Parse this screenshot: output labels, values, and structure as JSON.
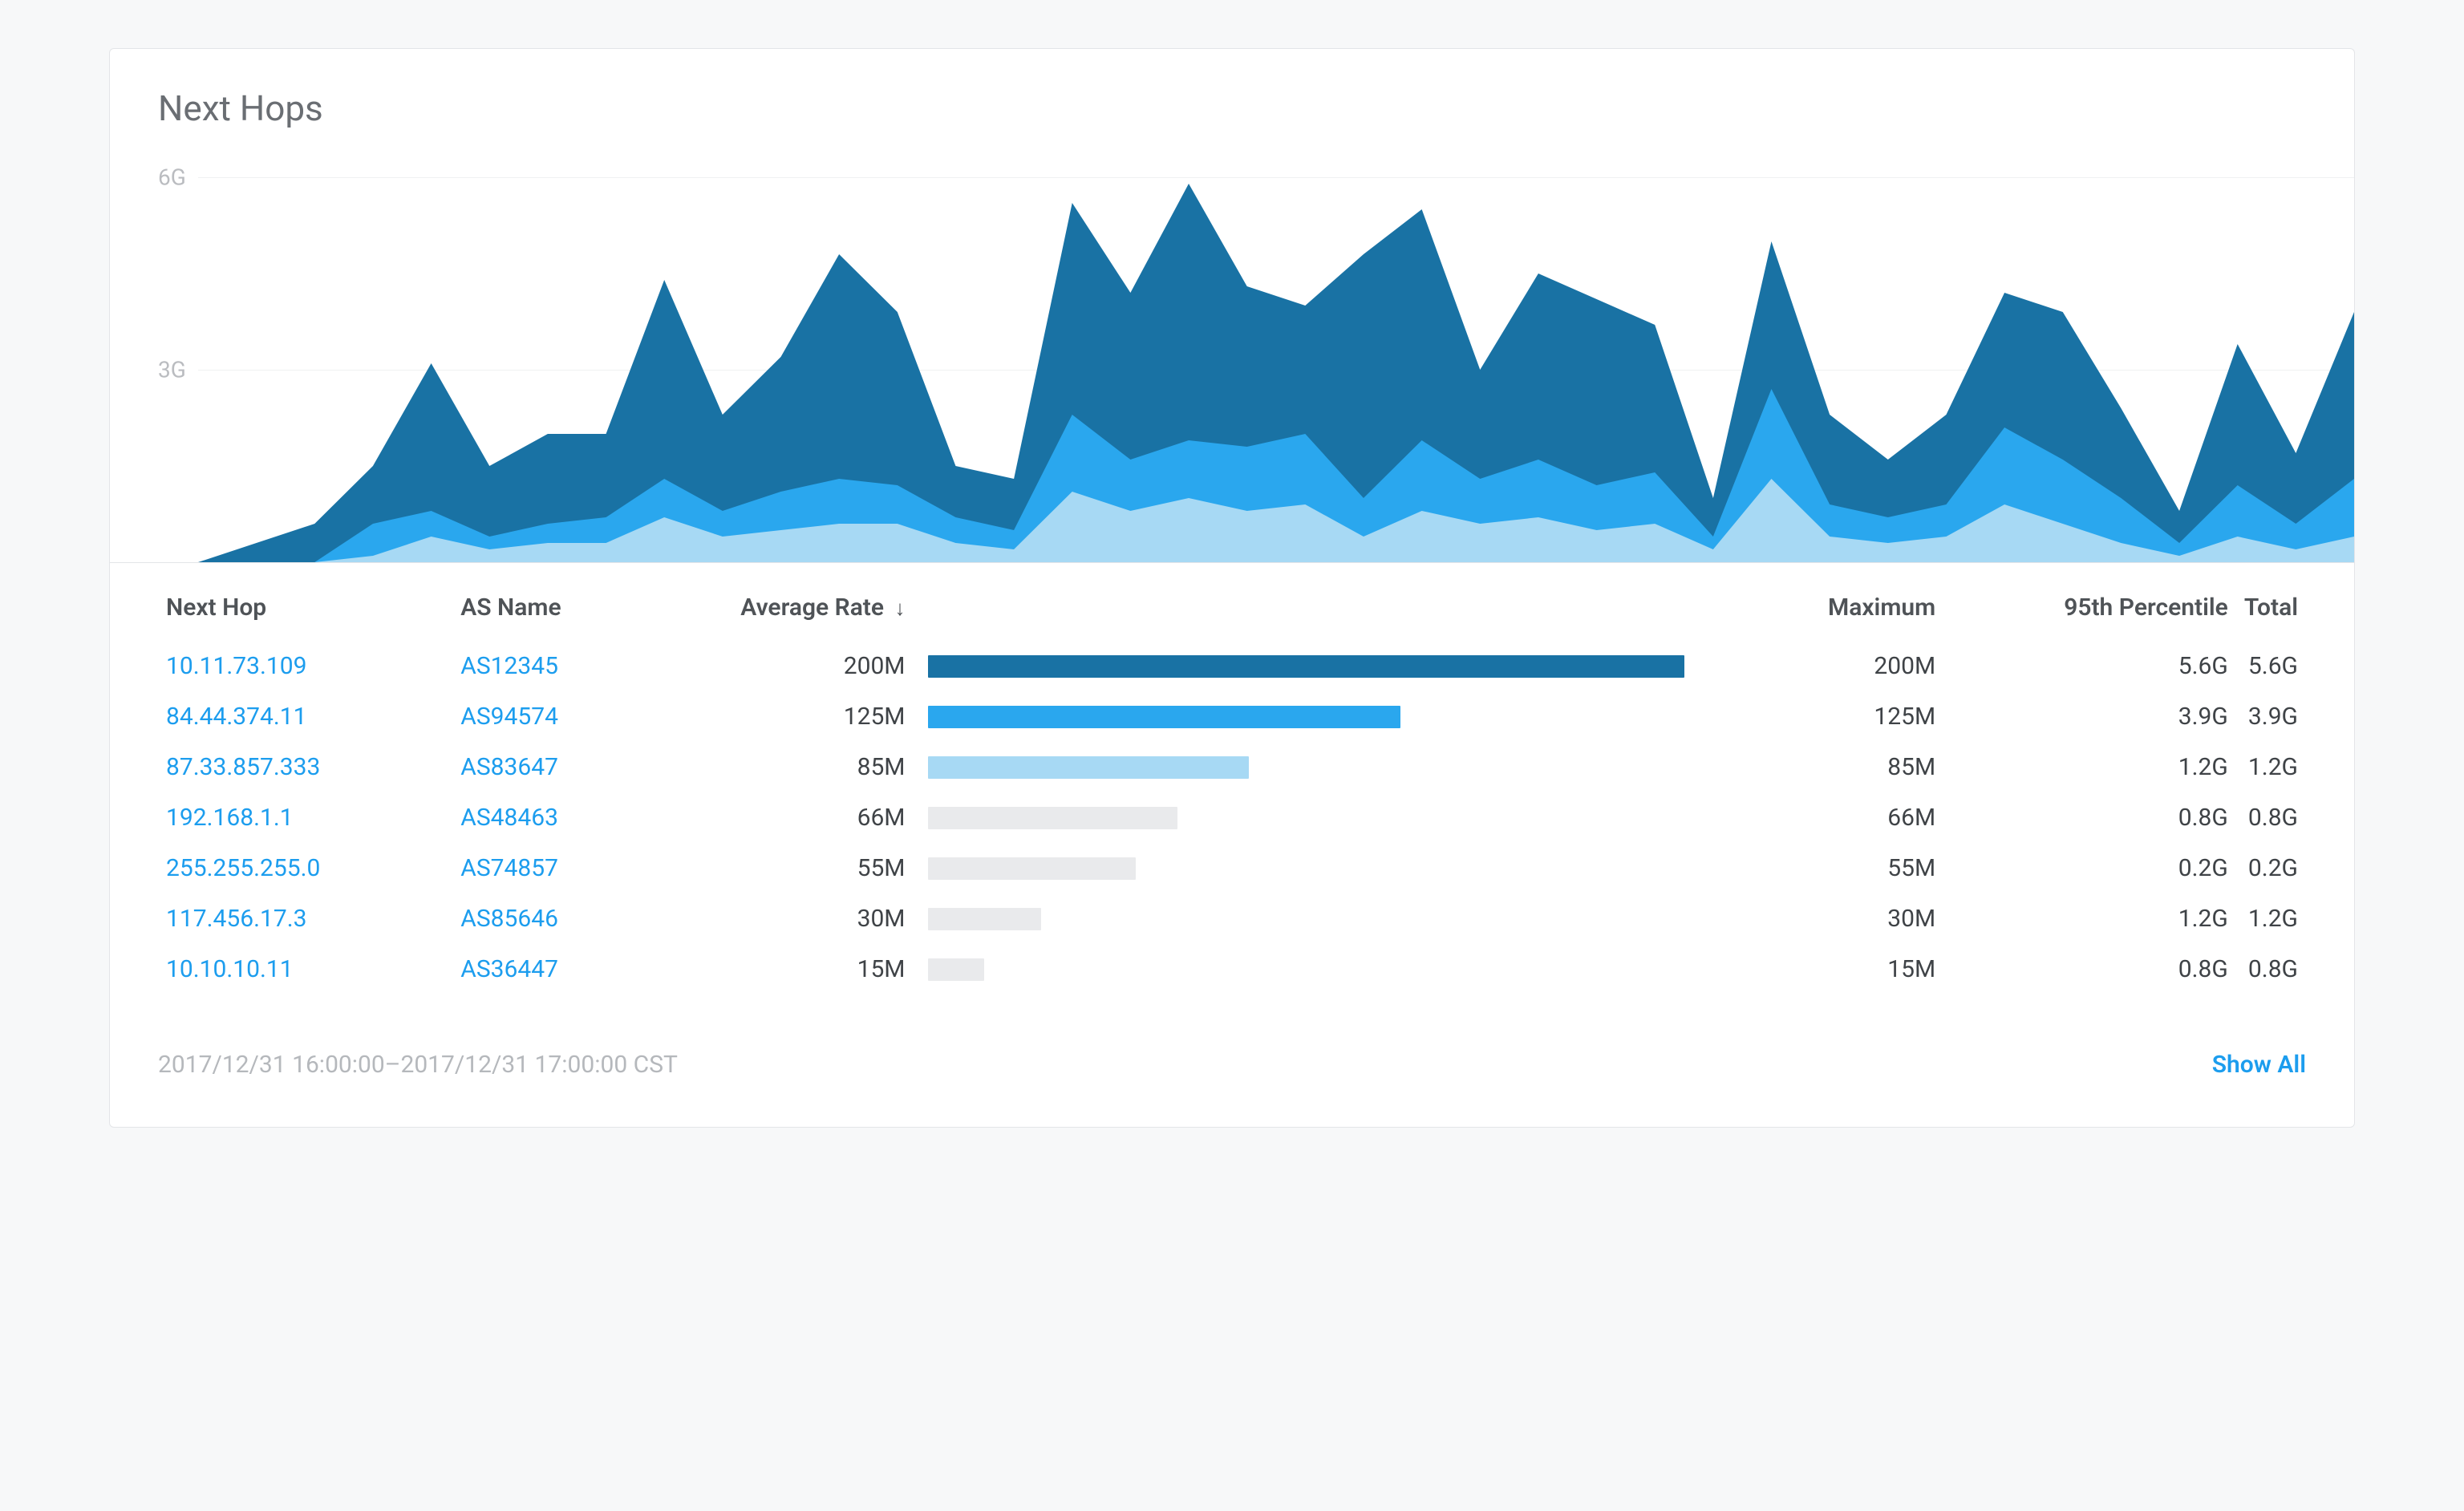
{
  "card": {
    "title": "Next Hops"
  },
  "chart_data": {
    "type": "area",
    "ylabel": "",
    "xlabel": "",
    "ylim": [
      0,
      6.5
    ],
    "y_ticks": [
      "3G",
      "6G"
    ],
    "x": [
      0,
      1,
      2,
      3,
      4,
      5,
      6,
      7,
      8,
      9,
      10,
      11,
      12,
      13,
      14,
      15,
      16,
      17,
      18,
      19,
      20,
      21,
      22,
      23,
      24,
      25,
      26,
      27,
      28,
      29,
      30,
      31,
      32,
      33,
      34,
      35,
      36,
      37
    ],
    "series": [
      {
        "name": "series-dark",
        "color": "#1972a4",
        "values": [
          0.0,
          0.3,
          0.6,
          1.5,
          3.1,
          1.5,
          2.0,
          2.0,
          4.4,
          2.3,
          3.2,
          4.8,
          3.9,
          1.5,
          1.3,
          5.6,
          4.2,
          5.9,
          4.3,
          4.0,
          4.8,
          5.5,
          3.0,
          4.5,
          4.1,
          3.7,
          1.0,
          5.0,
          2.3,
          1.6,
          2.3,
          4.2,
          3.9,
          2.4,
          0.8,
          3.4,
          1.7,
          3.9
        ]
      },
      {
        "name": "series-medium",
        "color": "#2aa7ee",
        "values": [
          0.0,
          0.0,
          0.0,
          0.6,
          0.8,
          0.4,
          0.6,
          0.7,
          1.3,
          0.8,
          1.1,
          1.3,
          1.2,
          0.7,
          0.5,
          2.3,
          1.6,
          1.9,
          1.8,
          2.0,
          1.0,
          1.9,
          1.3,
          1.6,
          1.2,
          1.4,
          0.4,
          2.7,
          0.9,
          0.7,
          0.9,
          2.1,
          1.6,
          1.0,
          0.3,
          1.2,
          0.6,
          1.3
        ]
      },
      {
        "name": "series-light",
        "color": "#a7d9f4",
        "values": [
          0.0,
          0.0,
          0.0,
          0.1,
          0.4,
          0.2,
          0.3,
          0.3,
          0.7,
          0.4,
          0.5,
          0.6,
          0.6,
          0.3,
          0.2,
          1.1,
          0.8,
          1.0,
          0.8,
          0.9,
          0.4,
          0.8,
          0.6,
          0.7,
          0.5,
          0.6,
          0.2,
          1.3,
          0.4,
          0.3,
          0.4,
          0.9,
          0.6,
          0.3,
          0.1,
          0.4,
          0.2,
          0.4
        ]
      }
    ]
  },
  "table": {
    "headers": {
      "next_hop": "Next Hop",
      "as_name": "AS Name",
      "avg_rate": "Average Rate",
      "max": "Maximum",
      "p95": "95th Percentile",
      "total": "Total"
    },
    "bar_colors": [
      "#1972a4",
      "#2aa7ee",
      "#a7d9f4",
      "#e9eaec",
      "#e9eaec",
      "#e9eaec",
      "#e9eaec"
    ],
    "bar_max": 200,
    "rows": [
      {
        "next_hop": "10.11.73.109",
        "as_name": "AS12345",
        "avg_rate": "200M",
        "avg_val": 200,
        "max": "200M",
        "p95": "5.6G",
        "total": "5.6G"
      },
      {
        "next_hop": "84.44.374.11",
        "as_name": "AS94574",
        "avg_rate": "125M",
        "avg_val": 125,
        "max": "125M",
        "p95": "3.9G",
        "total": "3.9G"
      },
      {
        "next_hop": "87.33.857.333",
        "as_name": "AS83647",
        "avg_rate": "85M",
        "avg_val": 85,
        "max": "85M",
        "p95": "1.2G",
        "total": "1.2G"
      },
      {
        "next_hop": "192.168.1.1",
        "as_name": "AS48463",
        "avg_rate": "66M",
        "avg_val": 66,
        "max": "66M",
        "p95": "0.8G",
        "total": "0.8G"
      },
      {
        "next_hop": "255.255.255.0",
        "as_name": "AS74857",
        "avg_rate": "55M",
        "avg_val": 55,
        "max": "55M",
        "p95": "0.2G",
        "total": "0.2G"
      },
      {
        "next_hop": "117.456.17.3",
        "as_name": "AS85646",
        "avg_rate": "30M",
        "avg_val": 30,
        "max": "30M",
        "p95": "1.2G",
        "total": "1.2G"
      },
      {
        "next_hop": "10.10.10.11",
        "as_name": "AS36447",
        "avg_rate": "15M",
        "avg_val": 15,
        "max": "15M",
        "p95": "0.8G",
        "total": "0.8G"
      }
    ]
  },
  "footer": {
    "timestamp": "2017/12/31 16:00:00–2017/12/31 17:00:00 CST",
    "show_all": "Show All"
  }
}
